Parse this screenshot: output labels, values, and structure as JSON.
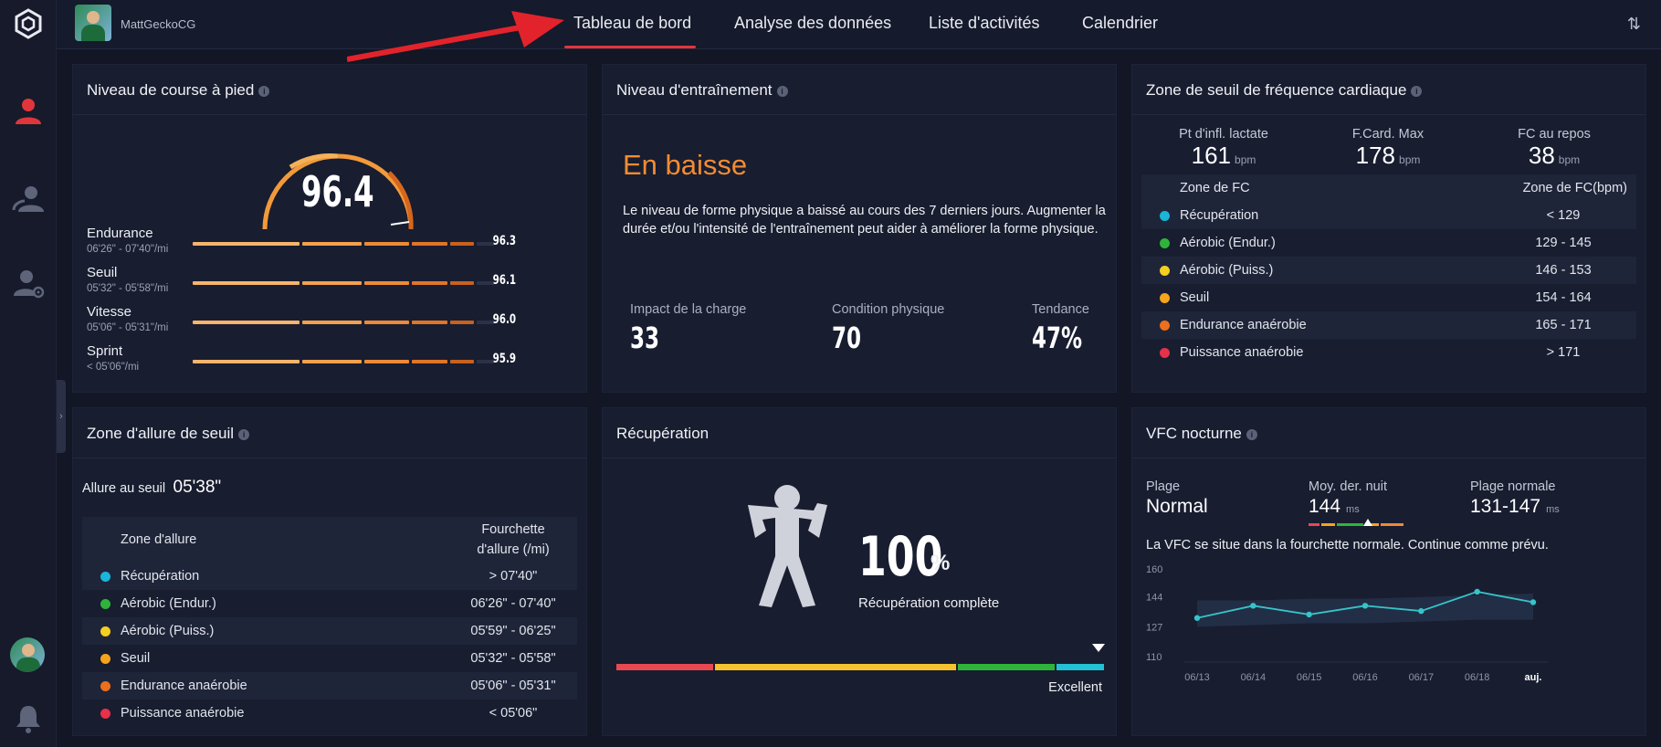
{
  "user": {
    "name": "MattGeckoCG"
  },
  "nav": {
    "tabs": [
      {
        "label": "Tableau de bord",
        "active": true
      },
      {
        "label": "Analyse des données"
      },
      {
        "label": "Liste d'activités"
      },
      {
        "label": "Calendrier"
      }
    ]
  },
  "sidebar": {
    "icons": [
      "profile-icon",
      "friends-icon",
      "user-settings-icon",
      "avatar",
      "bell-icon"
    ],
    "accent": "#e0363b"
  },
  "running_level": {
    "title": "Niveau de course à pied",
    "score": "96.4",
    "score_progress": 0.964,
    "rows": [
      {
        "label": "Endurance",
        "pace": "06'26\" - 07'40\"/mi",
        "value": "96.3"
      },
      {
        "label": "Seuil",
        "pace": "05'32\" - 05'58\"/mi",
        "value": "96.1"
      },
      {
        "label": "Vitesse",
        "pace": "05'06\" - 05'31\"/mi",
        "value": "96.0"
      },
      {
        "label": "Sprint",
        "pace": "< 05'06\"/mi",
        "value": "95.9"
      }
    ]
  },
  "training_level": {
    "title": "Niveau d'entraînement",
    "trend": "En baisse",
    "description": "Le niveau de forme physique a baissé au cours des 7 derniers jours. Augmenter la durée et/ou l'intensité de l'entraînement peut aider à améliorer la forme physique.",
    "stats": [
      {
        "label": "Impact de la charge",
        "value": "33"
      },
      {
        "label": "Condition physique",
        "value": "70"
      },
      {
        "label": "Tendance",
        "value": "47%"
      }
    ]
  },
  "hr_zone": {
    "title": "Zone de seuil de fréquence cardiaque",
    "top": [
      {
        "label": "Pt d'infl. lactate",
        "value": "161",
        "unit": "bpm"
      },
      {
        "label": "F.Card. Max",
        "value": "178",
        "unit": "bpm"
      },
      {
        "label": "FC au repos",
        "value": "38",
        "unit": "bpm"
      }
    ],
    "header": {
      "zone": "Zone de FC",
      "range": "Zone de FC(bpm)"
    },
    "rows": [
      {
        "name": "Récupération",
        "range": "< 129",
        "color": "#19b6d9"
      },
      {
        "name": "Aérobic (Endur.)",
        "range": "129 - 145",
        "color": "#2fb43a"
      },
      {
        "name": "Aérobic (Puiss.)",
        "range": "146 - 153",
        "color": "#f5cf1f"
      },
      {
        "name": "Seuil",
        "range": "154 - 164",
        "color": "#f4a51c"
      },
      {
        "name": "Endurance anaérobie",
        "range": "165 - 171",
        "color": "#ee6f1c"
      },
      {
        "name": "Puissance anaérobie",
        "range": "> 171",
        "color": "#e8304a"
      }
    ]
  },
  "pace_zone": {
    "title": "Zone d'allure de seuil",
    "threshold_label": "Allure au seuil",
    "threshold_value": "05'38\"",
    "header": {
      "zone": "Zone d'allure",
      "range_line1": "Fourchette",
      "range_line2": "d'allure (/mi)"
    },
    "rows": [
      {
        "name": "Récupération",
        "range": "> 07'40\"",
        "color": "#19b6d9"
      },
      {
        "name": "Aérobic (Endur.)",
        "range": "06'26\" - 07'40\"",
        "color": "#2fb43a"
      },
      {
        "name": "Aérobic (Puiss.)",
        "range": "05'59\" - 06'25\"",
        "color": "#f5cf1f"
      },
      {
        "name": "Seuil",
        "range": "05'32\" - 05'58\"",
        "color": "#f4a51c"
      },
      {
        "name": "Endurance anaérobie",
        "range": "05'06\" - 05'31\"",
        "color": "#ee6f1c"
      },
      {
        "name": "Puissance anaérobie",
        "range": "< 05'06\"",
        "color": "#e8304a"
      }
    ]
  },
  "recovery": {
    "title": "Récupération",
    "value": "100",
    "unit": "%",
    "label": "Récupération complète",
    "status": "Excellent",
    "level": 1.0
  },
  "hrv": {
    "title": "VFC nocturne",
    "range_label": "Plage",
    "range_value": "Normal",
    "avg_label": "Moy. der. nuit",
    "avg_value": "144",
    "avg_unit": "ms",
    "normal_label": "Plage normale",
    "normal_value": "131-147",
    "normal_unit": "ms",
    "message": "La VFC se situe dans la fourchette normale. Continue comme prévu."
  },
  "chart_data": {
    "type": "line",
    "x": [
      "06/13",
      "06/14",
      "06/15",
      "06/16",
      "06/17",
      "06/18",
      "auj."
    ],
    "series": [
      {
        "values": [
          132,
          139,
          134,
          139,
          136,
          147,
          141
        ]
      }
    ],
    "band": {
      "low": [
        127,
        128,
        129,
        129,
        130,
        131,
        131
      ],
      "high": [
        142,
        142,
        143,
        143,
        144,
        145,
        146
      ]
    },
    "yticks": [
      160,
      144,
      127,
      110
    ],
    "ylim": [
      110,
      160
    ]
  }
}
